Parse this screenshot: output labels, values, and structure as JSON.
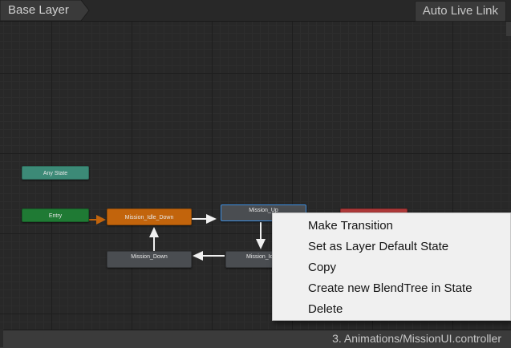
{
  "toolbar": {
    "breadcrumb": "Base Layer",
    "auto_live_link": "Auto Live Link"
  },
  "graph": {
    "nodes": {
      "any_state": "Any State",
      "entry": "Entry",
      "mission_idle_down": "Mission_Idle_Down",
      "mission_up": "Mission_Up",
      "mission_down": "Mission_Down",
      "mission_idle_partial": "Mission_Id"
    }
  },
  "context_menu": {
    "items": [
      "Make Transition",
      "Set as Layer Default State",
      "Copy",
      "Create new BlendTree in State",
      "Delete"
    ]
  },
  "status_bar": {
    "path": "3. Animations/MissionUI.controller"
  },
  "colors": {
    "any_state": "#3c8a77",
    "entry": "#1f7a34",
    "default_state": "#c2640c",
    "state": "#4a4d51",
    "selected_outline": "#3d8ee0",
    "exit_state": "#b13a3a"
  }
}
